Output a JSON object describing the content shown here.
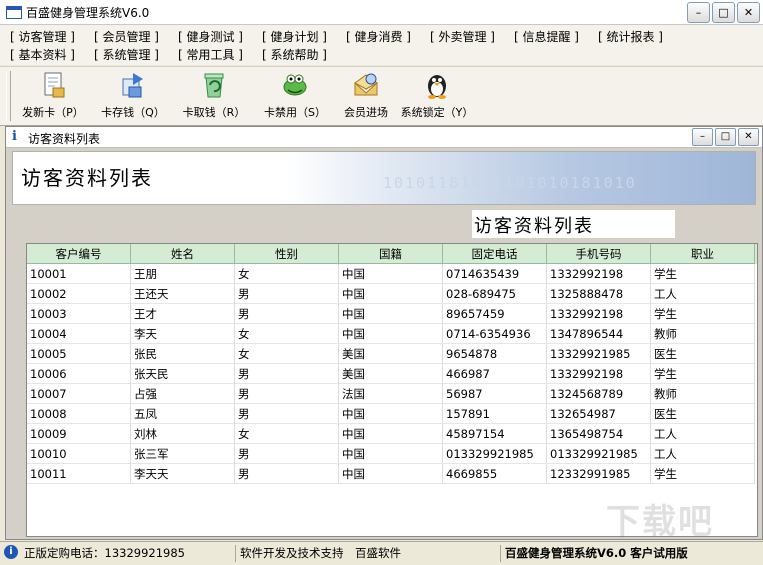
{
  "window": {
    "title": "百盛健身管理系统V6.0",
    "minimize": "–",
    "maximize": "□",
    "close": "✕"
  },
  "menu": {
    "row1": [
      "[ 访客管理 ]",
      "[ 会员管理 ]",
      "[ 健身测试 ]",
      "[ 健身计划 ]",
      "[ 健身消费 ]",
      "[ 外卖管理 ]",
      "[ 信息提醒 ]",
      "[ 统计报表 ]"
    ],
    "row2": [
      "[ 基本资料 ]",
      "[ 系统管理 ]",
      "[ 常用工具 ]",
      "[ 系统帮助 ]"
    ]
  },
  "toolbar": [
    {
      "label": "发新卡（P）",
      "icon": "new-card-icon"
    },
    {
      "label": "卡存钱（Q）",
      "icon": "deposit-icon"
    },
    {
      "label": "卡取钱（R）",
      "icon": "withdraw-icon"
    },
    {
      "label": "卡禁用（S）",
      "icon": "disable-card-icon"
    },
    {
      "label": "会员进场",
      "icon": "member-entry-icon"
    },
    {
      "label": "系统锁定（Y）",
      "icon": "system-lock-icon"
    }
  ],
  "child": {
    "title": "访客资料列表",
    "banner_title": "访客资料列表",
    "banner_digits": "10101181018101010181010",
    "subtitle": "访客资料列表"
  },
  "table": {
    "columns": [
      "客户编号",
      "姓名",
      "性别",
      "国籍",
      "固定电话",
      "手机号码",
      "职业"
    ],
    "rows": [
      [
        "10001",
        "王朋",
        "女",
        "中国",
        "0714635439",
        "1332992198",
        "学生"
      ],
      [
        "10002",
        "王还天",
        "男",
        "中国",
        "028-689475",
        "1325888478",
        "工人"
      ],
      [
        "10003",
        "王才",
        "男",
        "中国",
        "89657459",
        "1332992198",
        "学生"
      ],
      [
        "10004",
        "李天",
        "女",
        "中国",
        "0714-6354936",
        "1347896544",
        "教师"
      ],
      [
        "10005",
        "张民",
        "女",
        "美国",
        "9654878",
        "13329921985",
        "医生"
      ],
      [
        "10006",
        "张天民",
        "男",
        "美国",
        "466987",
        "1332992198",
        "学生"
      ],
      [
        "10007",
        "占强",
        "男",
        "法国",
        "56987",
        "1324568789",
        "教师"
      ],
      [
        "10008",
        "五凤",
        "男",
        "中国",
        "157891",
        "132654987",
        "医生"
      ],
      [
        "10009",
        "刘林",
        "女",
        "中国",
        "45897154",
        "1365498754",
        "工人"
      ],
      [
        "10010",
        "张三军",
        "男",
        "中国",
        "013329921985",
        "013329921985",
        "工人"
      ],
      [
        "10011",
        "李天天",
        "男",
        "中国",
        "4669855",
        "12332991985",
        "学生"
      ]
    ]
  },
  "status": {
    "phone": "正版定购电话：13329921985",
    "support": "软件开发及技术支持　百盛软件",
    "edition": "百盛健身管理系统V6.0 客户试用版"
  },
  "watermark": "下载吧"
}
